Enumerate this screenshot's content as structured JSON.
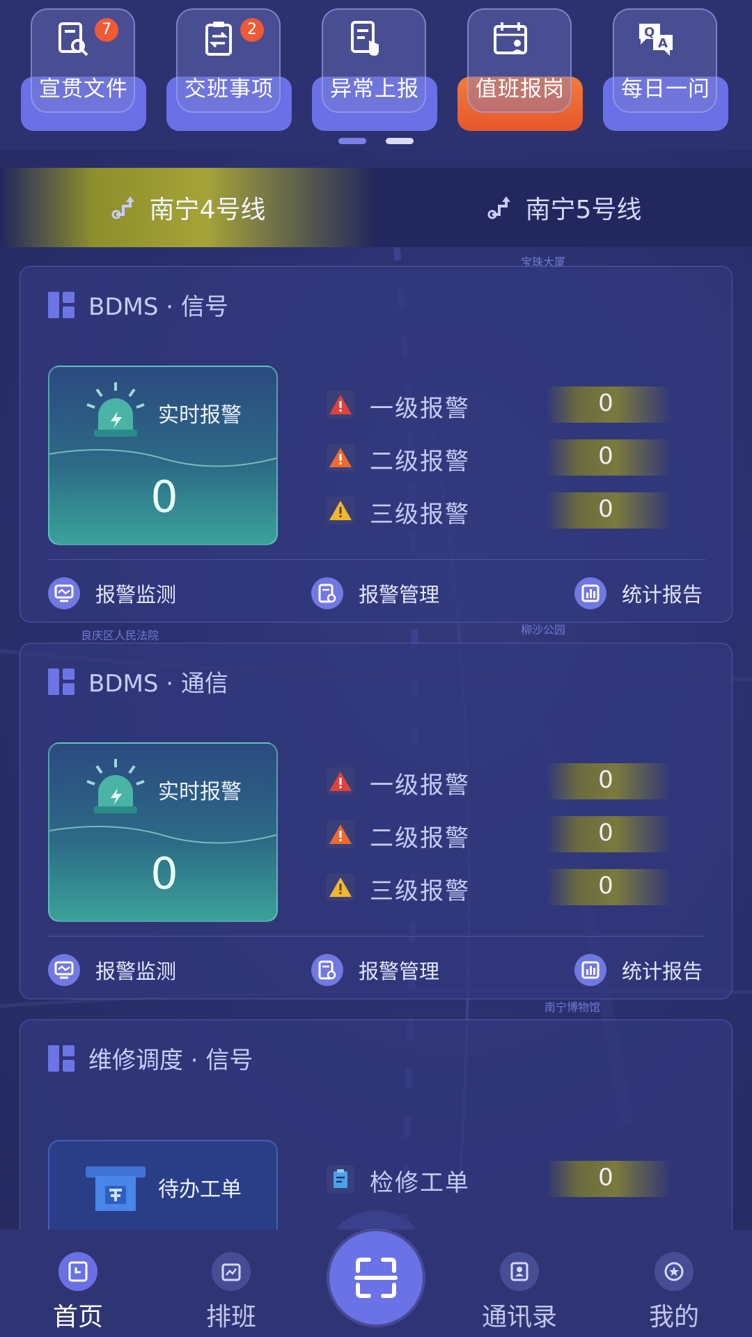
{
  "quick_actions": [
    {
      "label": "宣贯文件",
      "badge": "7",
      "icon": "document-search-icon",
      "accent": "#6b70e6"
    },
    {
      "label": "交班事项",
      "badge": "2",
      "icon": "clipboard-swap-icon",
      "accent": "#6b70e6"
    },
    {
      "label": "异常上报",
      "badge": "",
      "icon": "report-upload-icon",
      "accent": "#6b70e6"
    },
    {
      "label": "值班报岗",
      "badge": "",
      "icon": "duty-calendar-icon",
      "accent": "#ef6a30"
    },
    {
      "label": "每日一问",
      "badge": "",
      "icon": "qa-bubble-icon",
      "accent": "#6b70e6"
    }
  ],
  "line_tabs": [
    {
      "label": "南宁4号线",
      "active": true
    },
    {
      "label": "南宁5号线",
      "active": false
    }
  ],
  "map_labels": [
    "宝珠大厦",
    "良庆区人民法院",
    "柳沙公园",
    "南宁博物馆"
  ],
  "cards": [
    {
      "title": "BDMS · 信号",
      "realtime_label": "实时报警",
      "realtime_value": "0",
      "levels": [
        {
          "label": "一级报警",
          "value": "0",
          "color": "#e2423a"
        },
        {
          "label": "二级报警",
          "value": "0",
          "color": "#ee6a2c"
        },
        {
          "label": "三级报警",
          "value": "0",
          "color": "#f2b72c"
        }
      ],
      "actions": [
        {
          "label": "报警监测",
          "icon": "monitor-icon"
        },
        {
          "label": "报警管理",
          "icon": "manage-doc-icon"
        },
        {
          "label": "统计报告",
          "icon": "bar-chart-icon"
        }
      ]
    },
    {
      "title": "BDMS · 通信",
      "realtime_label": "实时报警",
      "realtime_value": "0",
      "levels": [
        {
          "label": "一级报警",
          "value": "0",
          "color": "#e2423a"
        },
        {
          "label": "二级报警",
          "value": "0",
          "color": "#ee6a2c"
        },
        {
          "label": "三级报警",
          "value": "0",
          "color": "#f2b72c"
        }
      ],
      "actions": [
        {
          "label": "报警监测",
          "icon": "monitor-icon"
        },
        {
          "label": "报警管理",
          "icon": "manage-doc-icon"
        },
        {
          "label": "统计报告",
          "icon": "bar-chart-icon"
        }
      ]
    },
    {
      "title": "维修调度 · 信号",
      "pending_label": "待办工单",
      "levels": [
        {
          "label": "检修工单",
          "value": "0",
          "color": "#4aa3e8"
        }
      ]
    }
  ],
  "bottom_nav": [
    {
      "label": "首页",
      "icon": "home-clock-icon",
      "active": true
    },
    {
      "label": "排班",
      "icon": "schedule-chart-icon",
      "active": false
    },
    {
      "label": "通讯录",
      "icon": "contacts-icon",
      "active": false
    },
    {
      "label": "我的",
      "icon": "profile-star-icon",
      "active": false
    }
  ],
  "scan_button": {
    "icon": "scan-icon"
  }
}
